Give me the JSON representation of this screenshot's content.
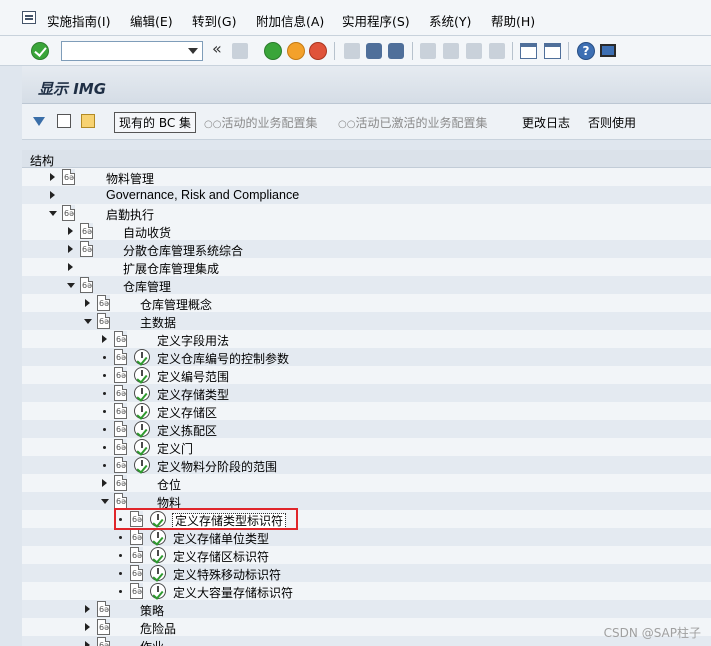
{
  "menubar": {
    "items": [
      "实施指南(I)",
      "编辑(E)",
      "转到(G)",
      "附加信息(A)",
      "实用程序(S)",
      "系统(Y)",
      "帮助(H)"
    ]
  },
  "toolbar": {
    "command_field_value": "",
    "back_glyph": "«"
  },
  "screen": {
    "title": "显示 IMG"
  },
  "app_toolbar": {
    "bc_button": "现有的 BC 集",
    "activated_bc_button": "活动的业务配置集",
    "activated_done_bc_button": "活动已激活的业务配置集",
    "change_log_button": "更改日志",
    "otherwise_button": "否则使用"
  },
  "tree": {
    "header": "结构",
    "nodes": [
      {
        "label": "物料管理"
      },
      {
        "label": "Governance, Risk and Compliance"
      },
      {
        "label": "启勤执行"
      },
      {
        "label": "自动收货"
      },
      {
        "label": "分散仓库管理系统综合"
      },
      {
        "label": "扩展仓库管理集成"
      },
      {
        "label": "仓库管理"
      },
      {
        "label": "仓库管理概念"
      },
      {
        "label": "主数据"
      },
      {
        "label": "定义字段用法"
      },
      {
        "label": "定义仓库编号的控制参数"
      },
      {
        "label": "定义编号范围"
      },
      {
        "label": "定义存储类型"
      },
      {
        "label": "定义存储区"
      },
      {
        "label": "定义拣配区"
      },
      {
        "label": "定义门"
      },
      {
        "label": "定义物料分阶段的范围"
      },
      {
        "label": "仓位"
      },
      {
        "label": "物料"
      },
      {
        "label": "定义存储类型标识符"
      },
      {
        "label": "定义存储单位类型"
      },
      {
        "label": "定义存储区标识符"
      },
      {
        "label": "定义特殊移动标识符"
      },
      {
        "label": "定义大容量存储标识符"
      },
      {
        "label": "策略"
      },
      {
        "label": "危险品"
      },
      {
        "label": "作业"
      }
    ]
  },
  "watermark": "CSDN @SAP柱子",
  "colors": {
    "highlight_box": "#e0262b",
    "execute_check": "#2e9a2e"
  }
}
